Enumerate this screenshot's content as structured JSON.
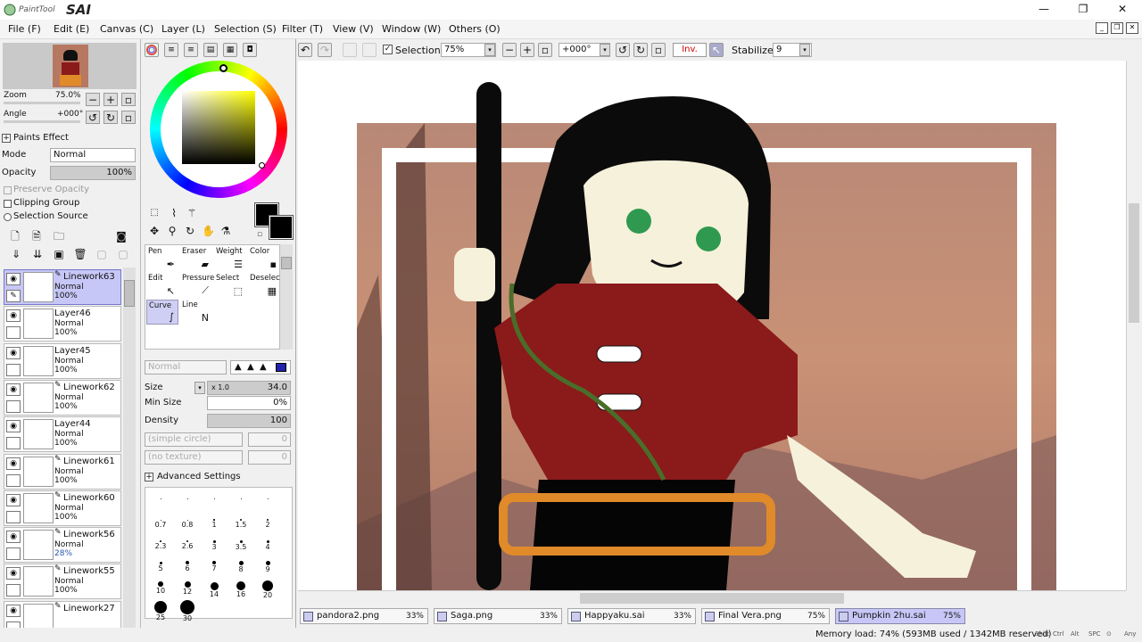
{
  "app": {
    "logo_small": "PaintTool",
    "logo_big": "SAI"
  },
  "window_controls": {
    "minimize": "—",
    "maximize": "❐",
    "close": "✕"
  },
  "menu": [
    "File (F)",
    "Edit (E)",
    "Canvas (C)",
    "Layer (L)",
    "Selection (S)",
    "Filter (T)",
    "View (V)",
    "Window (W)",
    "Others (O)"
  ],
  "toolbar": {
    "selection_label": "Selection",
    "zoom_value": "75%",
    "angle_value": "+000°",
    "invert_label": "Inv.",
    "stabilizer_label": "Stabilizer",
    "stabilizer_value": "9"
  },
  "navigator": {
    "zoom_label": "Zoom",
    "zoom_value": "75.0%",
    "angle_label": "Angle",
    "angle_value": "+000°"
  },
  "paints_effect": {
    "header": "Paints Effect",
    "mode_label": "Mode",
    "mode_value": "Normal",
    "opacity_label": "Opacity",
    "opacity_value": "100%",
    "opacity_fraction": 1.0,
    "preserve_opacity": "Preserve Opacity",
    "clipping_group": "Clipping Group",
    "selection_source": "Selection Source"
  },
  "layers": [
    {
      "name": "Linework63",
      "mode": "Normal",
      "opacity": "100%",
      "pen": true,
      "selected": true
    },
    {
      "name": "Layer46",
      "mode": "Normal",
      "opacity": "100%",
      "pen": false,
      "selected": false
    },
    {
      "name": "Layer45",
      "mode": "Normal",
      "opacity": "100%",
      "pen": false,
      "selected": false
    },
    {
      "name": "Linework62",
      "mode": "Normal",
      "opacity": "100%",
      "pen": true,
      "selected": false
    },
    {
      "name": "Layer44",
      "mode": "Normal",
      "opacity": "100%",
      "pen": false,
      "selected": false
    },
    {
      "name": "Linework61",
      "mode": "Normal",
      "opacity": "100%",
      "pen": true,
      "selected": false
    },
    {
      "name": "Linework60",
      "mode": "Normal",
      "opacity": "100%",
      "pen": true,
      "selected": false
    },
    {
      "name": "Linework56",
      "mode": "Normal",
      "opacity": "28%",
      "pen": true,
      "selected": false
    },
    {
      "name": "Linework55",
      "mode": "Normal",
      "opacity": "100%",
      "pen": true,
      "selected": false
    },
    {
      "name": "Linework27",
      "mode": "",
      "opacity": "",
      "pen": true,
      "selected": false
    }
  ],
  "tools": [
    {
      "label": "Pen",
      "icon": "✒",
      "icon_name": "pen-icon",
      "selected": false
    },
    {
      "label": "Eraser",
      "icon": "▰",
      "icon_name": "eraser-icon",
      "selected": false
    },
    {
      "label": "Weight",
      "icon": "☰",
      "icon_name": "weight-icon",
      "selected": false
    },
    {
      "label": "Color",
      "icon": "▪",
      "icon_name": "color-icon",
      "selected": false
    },
    {
      "label": "Edit",
      "icon": "↖",
      "icon_name": "edit-icon",
      "selected": false
    },
    {
      "label": "Pressure",
      "icon": "⟋",
      "icon_name": "pressure-icon",
      "selected": false
    },
    {
      "label": "Select",
      "icon": "⬚",
      "icon_name": "select-icon",
      "selected": false
    },
    {
      "label": "Deselect",
      "icon": "▦",
      "icon_name": "deselect-icon",
      "selected": false
    },
    {
      "label": "Curve",
      "icon": "∫",
      "icon_name": "curve-icon",
      "selected": true
    },
    {
      "label": "Line",
      "icon": "N",
      "icon_name": "line-icon",
      "selected": false
    }
  ],
  "tool_settings": {
    "blend_mode": "Normal",
    "size_label": "Size",
    "size_multiplier": "x 1.0",
    "size_value": "34.0",
    "min_size_label": "Min Size",
    "min_size_value": "0%",
    "density_label": "Density",
    "density_value": "100",
    "shape": "(simple circle)",
    "shape_value": "0",
    "texture": "(no texture)",
    "texture_value": "0",
    "advanced": "Advanced Settings"
  },
  "brush_sizes": [
    "",
    "",
    "",
    "",
    "",
    "0.7",
    "0.8",
    "1",
    "1.5",
    "2",
    "2.3",
    "2.6",
    "3",
    "3.5",
    "4",
    "5",
    "6",
    "7",
    "8",
    "9",
    "10",
    "12",
    "14",
    "16",
    "20",
    "25",
    "30"
  ],
  "document_tabs": [
    {
      "name": "pandora2.png",
      "zoom": "33%",
      "selected": false
    },
    {
      "name": "Saga.png",
      "zoom": "33%",
      "selected": false
    },
    {
      "name": "Happyaku.sai",
      "zoom": "33%",
      "selected": false
    },
    {
      "name": "Final Vera.png",
      "zoom": "75%",
      "selected": false
    },
    {
      "name": "Pumpkin 2hu.sai",
      "zoom": "75%",
      "selected": true
    }
  ],
  "status": {
    "memory": "Memory load: 74% (593MB used / 1342MB reserved)",
    "keys": [
      "Shift",
      "Ctrl",
      "Alt",
      "SPC",
      "⊙",
      "Any"
    ]
  },
  "colors": {
    "accent": "#c7c7f7",
    "primary_color": "#000000",
    "secondary_color": "#000000",
    "bg_sky": "#c99276",
    "shirt": "#8b1a1a"
  }
}
